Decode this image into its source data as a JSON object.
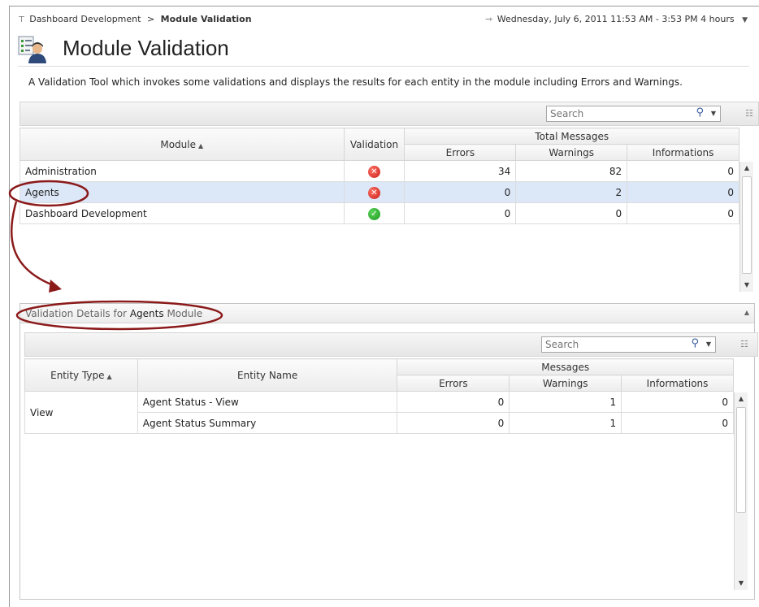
{
  "breadcrumb": {
    "parent": "Dashboard Development",
    "separator": ">",
    "current": "Module Validation"
  },
  "time_range": {
    "text": "Wednesday, July 6, 2011 11:53 AM - 3:53 PM 4 hours"
  },
  "page": {
    "title": "Module Validation",
    "description": "A Validation Tool which invokes some validations and displays the results for each entity in the module including Errors and Warnings."
  },
  "modules_grid": {
    "search_placeholder": "Search",
    "columns": {
      "module": "Module",
      "validation": "Validation",
      "total_messages": "Total Messages",
      "errors": "Errors",
      "warnings": "Warnings",
      "informations": "Informations"
    },
    "rows": [
      {
        "module": "Administration",
        "validation": "error",
        "errors": "34",
        "warnings": "82",
        "informations": "0"
      },
      {
        "module": "Agents",
        "validation": "error",
        "errors": "0",
        "warnings": "2",
        "informations": "0",
        "selected": true
      },
      {
        "module": "Dashboard Development",
        "validation": "ok",
        "errors": "0",
        "warnings": "0",
        "informations": "0"
      }
    ]
  },
  "details_panel": {
    "title_prefix": "Validation Details for",
    "title_module": "Agents",
    "title_suffix": "Module",
    "search_placeholder": "Search",
    "columns": {
      "entity_type": "Entity Type",
      "entity_name": "Entity Name",
      "messages": "Messages",
      "errors": "Errors",
      "warnings": "Warnings",
      "informations": "Informations"
    },
    "group": "View",
    "rows": [
      {
        "entity_name": "Agent Status - View",
        "errors": "0",
        "warnings": "1",
        "informations": "0"
      },
      {
        "entity_name": "Agent Status Summary",
        "errors": "0",
        "warnings": "1",
        "informations": "0"
      }
    ]
  },
  "colors": {
    "selected_row": "#dce7f7",
    "annotation": "#8b1a1a",
    "error": "#c8201b",
    "ok": "#1e9a1e"
  }
}
